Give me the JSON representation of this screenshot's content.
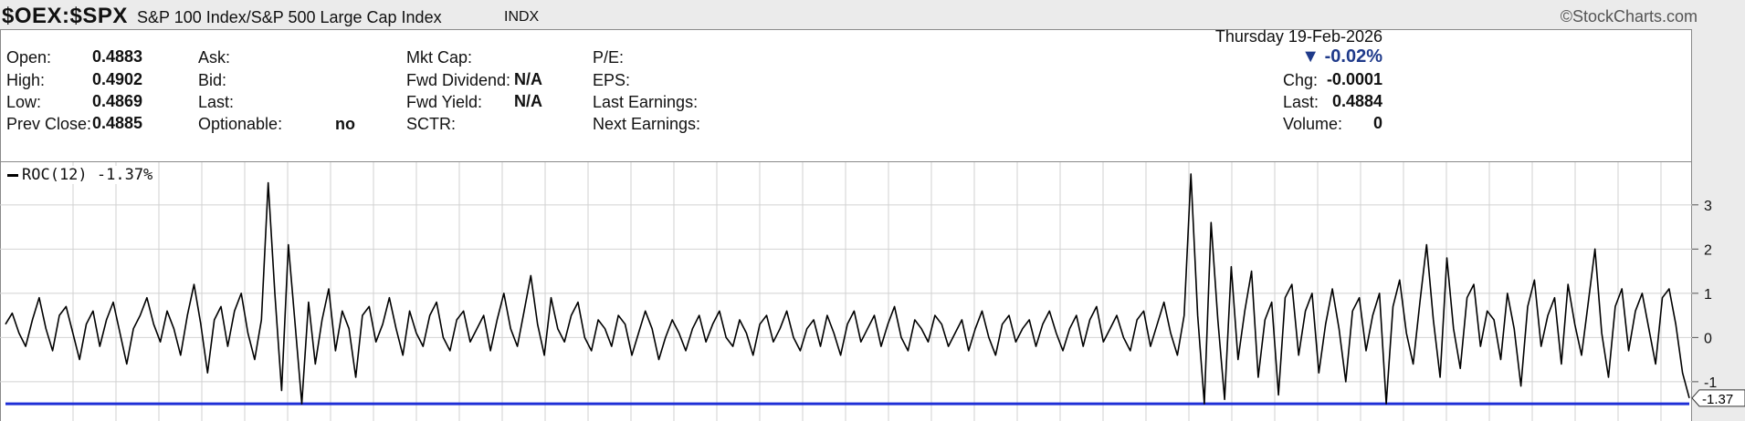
{
  "header": {
    "symbol": "$OEX:$SPX",
    "description": "S&P 100 Index/S&P 500 Large Cap Index",
    "exchange": "INDX",
    "brand": "©StockCharts.com"
  },
  "quote": {
    "date": "Thursday  19-Feb-2026",
    "change_pct": "▼ -0.02%",
    "open_label": "Open:",
    "open": "0.4883",
    "high_label": "High:",
    "high": "0.4902",
    "low_label": "Low:",
    "low": "0.4869",
    "prev_close_label": "Prev Close:",
    "prev_close": "0.4885",
    "ask_label": "Ask:",
    "bid_label": "Bid:",
    "last_label_mid": "Last:",
    "optionable_label": "Optionable:",
    "optionable": "no",
    "mkt_cap_label": "Mkt Cap:",
    "fwd_dividend_label": "Fwd Dividend:",
    "fwd_dividend": "N/A",
    "fwd_yield_label": "Fwd Yield:",
    "fwd_yield": "N/A",
    "sctr_label": "SCTR:",
    "pe_label": "P/E:",
    "eps_label": "EPS:",
    "last_earnings_label": "Last Earnings:",
    "next_earnings_label": "Next Earnings:",
    "chg_label": "Chg:",
    "chg": "-0.0001",
    "last_label": "Last:",
    "last": "0.4884",
    "volume_label": "Volume:",
    "volume": "0"
  },
  "colors": {
    "line": "#000000",
    "reference_line": "#1f2fd6",
    "down": "#1f3a8a",
    "grid": "#d2d2d2"
  },
  "chart_data": {
    "type": "line",
    "title": "",
    "legend": "ROC(12) -1.37%",
    "series": [
      {
        "name": "ROC(12)",
        "values": [
          0.3,
          0.55,
          0.1,
          -0.2,
          0.4,
          0.9,
          0.2,
          -0.3,
          0.5,
          0.7,
          0.1,
          -0.5,
          0.3,
          0.6,
          -0.2,
          0.4,
          0.8,
          0.1,
          -0.6,
          0.2,
          0.5,
          0.9,
          0.3,
          -0.1,
          0.6,
          0.2,
          -0.4,
          0.5,
          1.2,
          0.3,
          -0.8,
          0.4,
          0.7,
          -0.2,
          0.6,
          1.0,
          0.1,
          -0.5,
          0.4,
          3.5,
          1.0,
          -1.2,
          2.1,
          0.3,
          -1.5,
          0.8,
          -0.6,
          0.4,
          1.1,
          -0.3,
          0.6,
          0.2,
          -0.9,
          0.5,
          0.7,
          -0.1,
          0.3,
          0.9,
          0.2,
          -0.4,
          0.6,
          0.1,
          -0.2,
          0.5,
          0.8,
          0.0,
          -0.3,
          0.4,
          0.6,
          -0.1,
          0.2,
          0.5,
          -0.3,
          0.4,
          1.0,
          0.2,
          -0.2,
          0.6,
          1.4,
          0.3,
          -0.4,
          0.9,
          0.2,
          -0.1,
          0.5,
          0.8,
          0.0,
          -0.3,
          0.4,
          0.2,
          -0.2,
          0.5,
          0.3,
          -0.4,
          0.1,
          0.6,
          0.2,
          -0.5,
          0.0,
          0.4,
          0.1,
          -0.3,
          0.2,
          0.5,
          -0.1,
          0.3,
          0.6,
          0.0,
          -0.2,
          0.4,
          0.1,
          -0.4,
          0.3,
          0.5,
          -0.1,
          0.2,
          0.6,
          0.0,
          -0.3,
          0.2,
          0.4,
          -0.2,
          0.5,
          0.1,
          -0.4,
          0.3,
          0.6,
          -0.1,
          0.2,
          0.5,
          -0.2,
          0.3,
          0.7,
          0.0,
          -0.3,
          0.4,
          0.2,
          -0.1,
          0.5,
          0.3,
          -0.2,
          0.1,
          0.4,
          -0.3,
          0.2,
          0.6,
          0.0,
          -0.4,
          0.3,
          0.5,
          -0.1,
          0.2,
          0.4,
          -0.2,
          0.3,
          0.6,
          0.1,
          -0.3,
          0.2,
          0.5,
          -0.2,
          0.4,
          0.7,
          -0.1,
          0.2,
          0.5,
          0.0,
          -0.3,
          0.4,
          0.6,
          -0.2,
          0.3,
          0.8,
          0.1,
          -0.4,
          0.5,
          3.7,
          0.5,
          -1.5,
          2.6,
          0.4,
          -1.4,
          1.6,
          -0.5,
          0.6,
          1.5,
          -0.9,
          0.4,
          0.8,
          -1.3,
          0.9,
          1.2,
          -0.4,
          0.6,
          1.0,
          -0.8,
          0.3,
          1.1,
          0.2,
          -1.0,
          0.6,
          0.9,
          -0.3,
          0.5,
          1.0,
          -1.5,
          0.7,
          1.3,
          0.1,
          -0.6,
          0.8,
          2.1,
          0.4,
          -0.9,
          1.8,
          0.2,
          -0.7,
          0.9,
          1.2,
          -0.2,
          0.6,
          0.4,
          -0.5,
          1.0,
          0.2,
          -1.1,
          0.7,
          1.3,
          -0.2,
          0.5,
          0.9,
          -0.6,
          1.2,
          0.3,
          -0.4,
          0.8,
          2.0,
          0.1,
          -0.9,
          0.7,
          1.1,
          -0.3,
          0.6,
          1.0,
          0.2,
          -0.6,
          0.9,
          1.1,
          0.3,
          -0.8,
          -1.37
        ]
      }
    ],
    "ylim": [
      -1.6,
      3.8
    ],
    "yticks": [
      3,
      2,
      1,
      0,
      -1
    ],
    "reference_line": -1.5,
    "last_value_label": "-1.37",
    "grid": true
  }
}
